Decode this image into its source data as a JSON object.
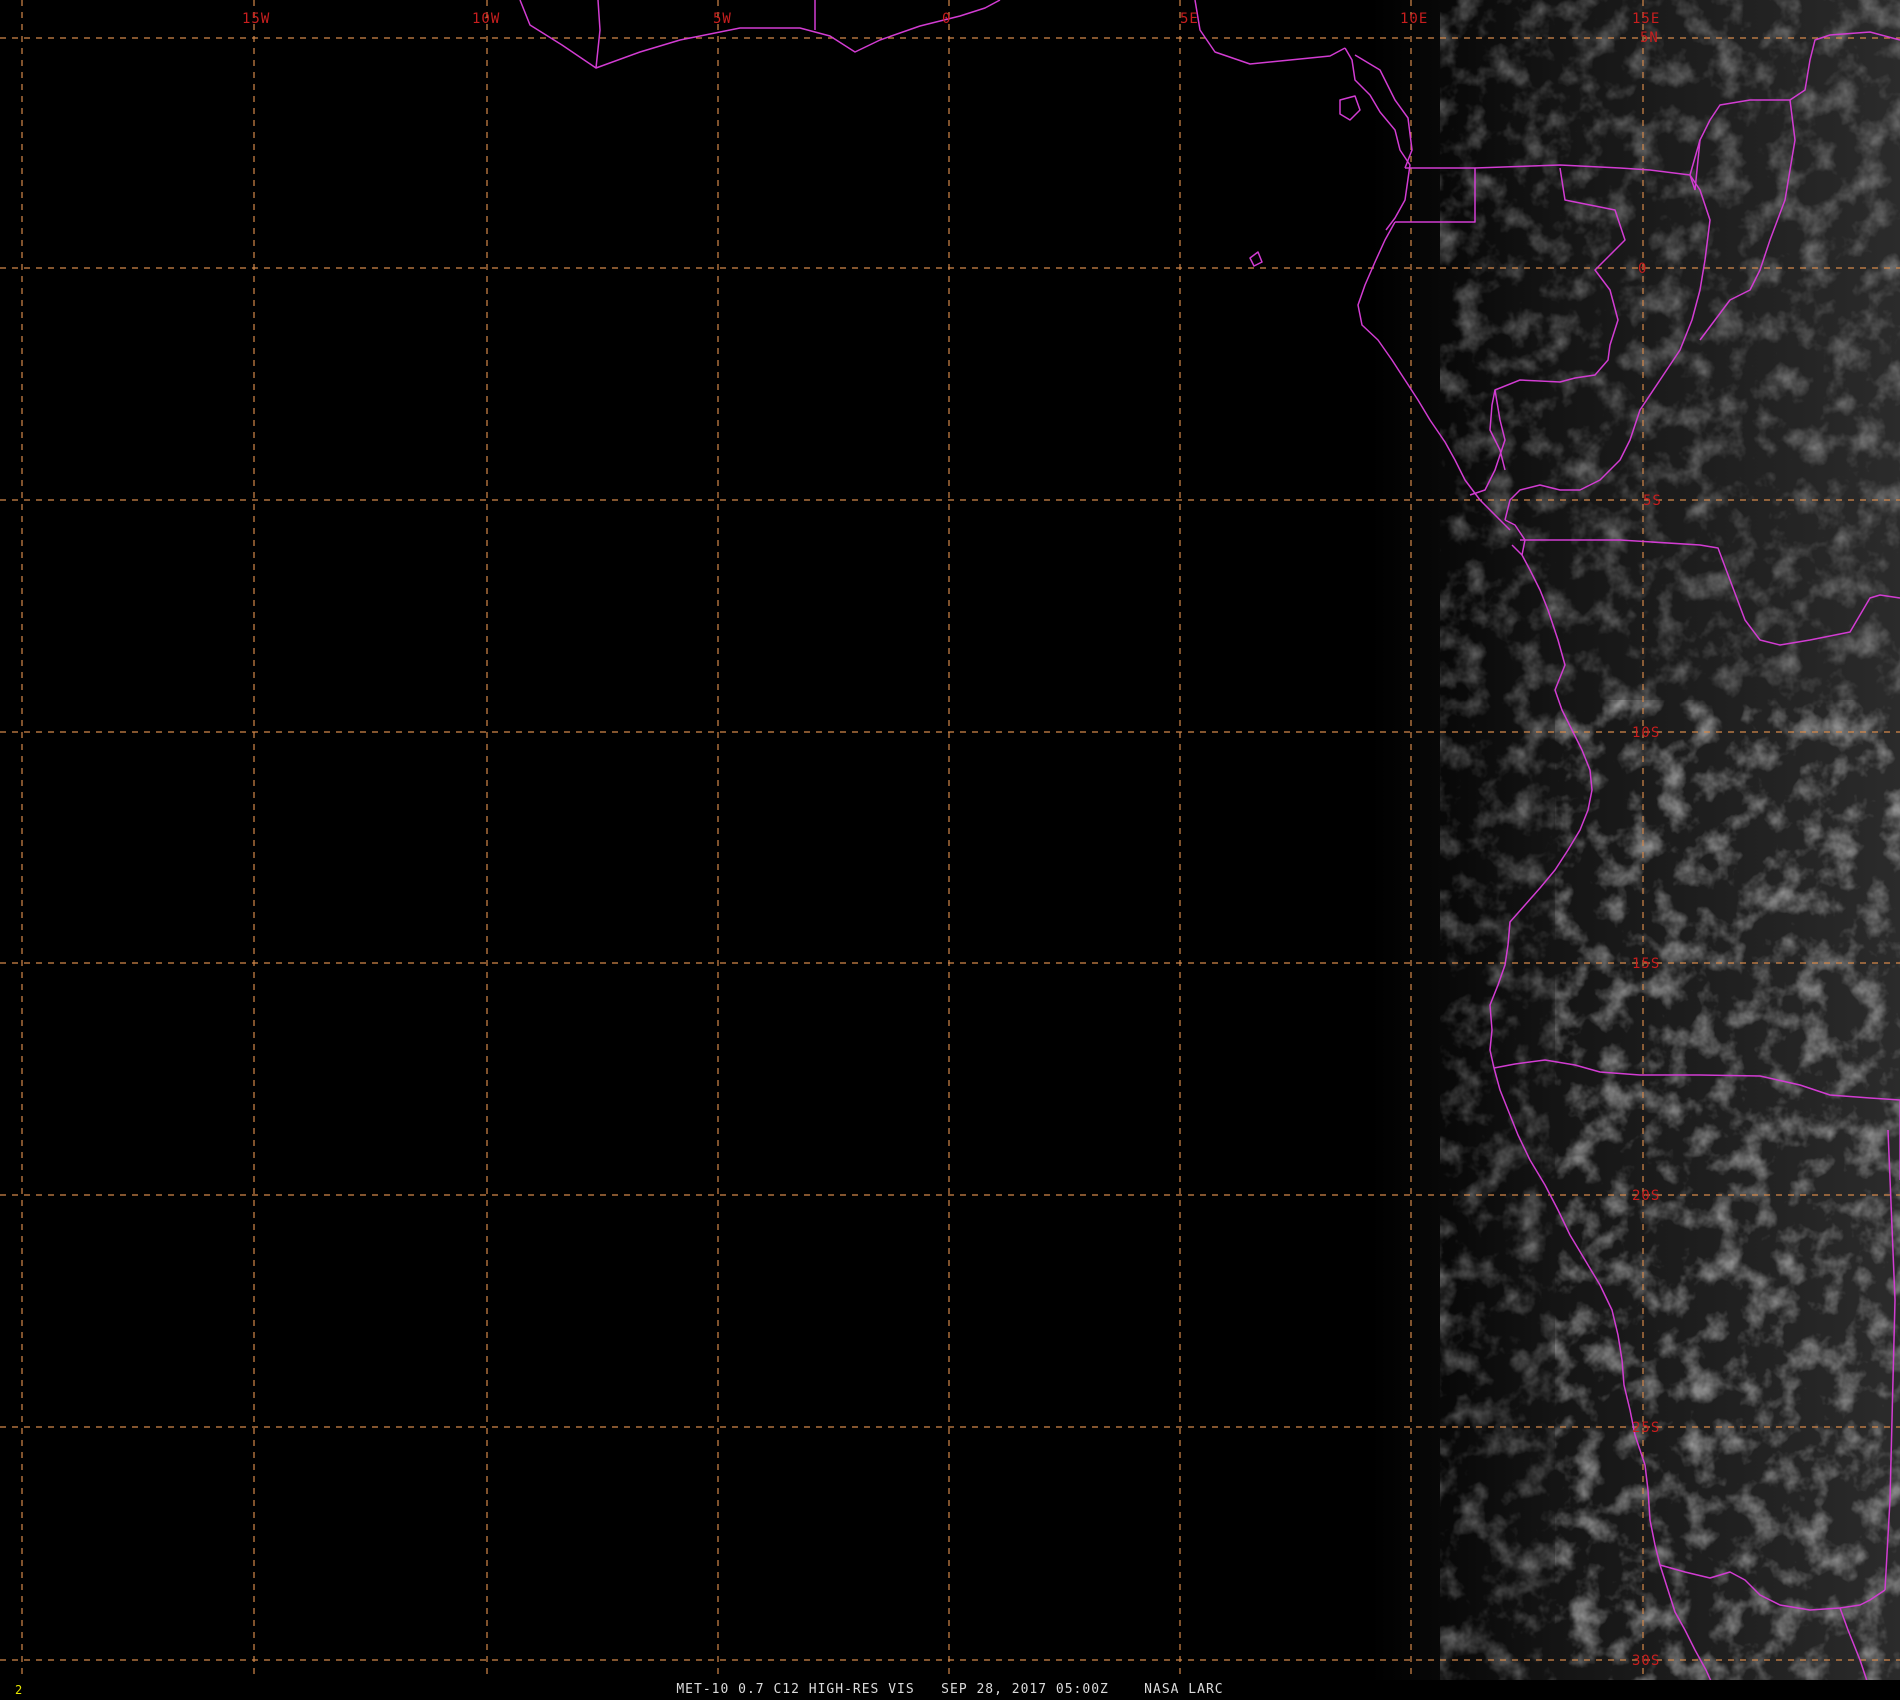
{
  "map": {
    "type": "satellite-imagery",
    "longitude_labels": [
      "15W",
      "10W",
      "5W",
      "0",
      "5E",
      "10E",
      "15E"
    ],
    "latitude_labels": [
      "5N",
      "0",
      "5S",
      "10S",
      "15S",
      "20S",
      "25S",
      "30S"
    ],
    "grid_color": "#d4884a",
    "label_color": "#c81e1e",
    "border_color": "#d23cd2"
  },
  "status_bar": {
    "frame_number": "2",
    "caption": "MET-10 0.7 C12 HIGH-RES VIS   SEP 28, 2017 05:00Z    NASA LARC"
  }
}
